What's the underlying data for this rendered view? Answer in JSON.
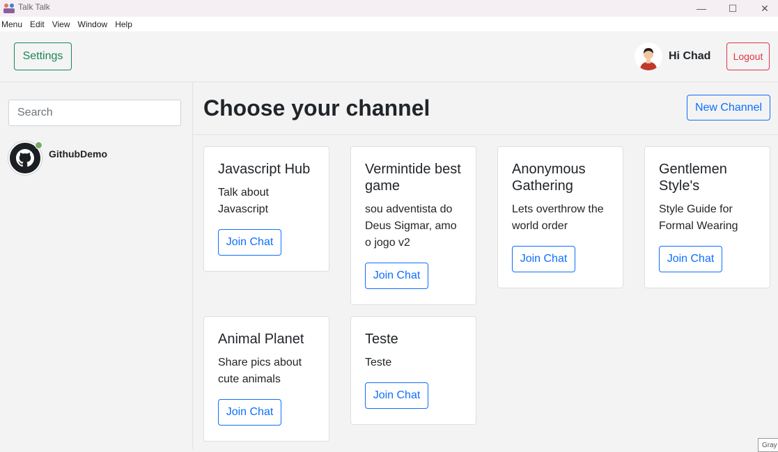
{
  "window": {
    "title": "Talk Talk",
    "minimize_glyph": "—",
    "maximize_glyph": "☐",
    "close_glyph": "✕"
  },
  "menubar": [
    "Menu",
    "Edit",
    "View",
    "Window",
    "Help"
  ],
  "header": {
    "settings_label": "Settings",
    "greeting": "Hi Chad",
    "logout_label": "Logout"
  },
  "sidebar": {
    "search_placeholder": "Search",
    "contacts": [
      {
        "name": "GithubDemo",
        "status": "online",
        "icon": "github-icon"
      }
    ]
  },
  "main": {
    "title": "Choose your channel",
    "new_channel_label": "New Channel",
    "channels": [
      {
        "title": "Javascript Hub",
        "description": "Talk about Javascript",
        "button": "Join Chat"
      },
      {
        "title": "Vermintide best game",
        "description": "sou adventista do Deus Sigmar, amo o jogo v2",
        "button": "Join Chat"
      },
      {
        "title": "Anonymous Gathering",
        "description": "Lets overthrow the world order",
        "button": "Join Chat"
      },
      {
        "title": "Gentlemen Style's",
        "description": "Style Guide for Formal Wearing",
        "button": "Join Chat"
      },
      {
        "title": "Animal Planet",
        "description": "Share pics about cute animals",
        "button": "Join Chat"
      },
      {
        "title": "Teste",
        "description": "Teste",
        "button": "Join Chat"
      }
    ]
  },
  "corner_text": "Gray",
  "colors": {
    "success": "#198754",
    "danger": "#dc3545",
    "primary": "#0d6efd"
  }
}
